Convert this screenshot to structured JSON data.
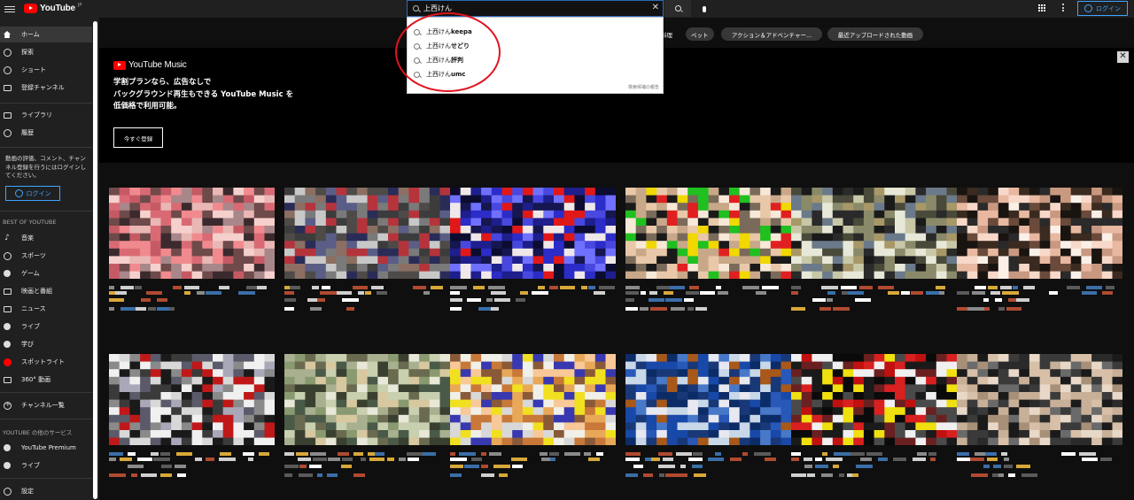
{
  "header": {
    "logo_text": "YouTube",
    "logo_badge": "JP",
    "search_value": "上西けん",
    "login_label": "ログイン"
  },
  "icons": [
    "menu-icon",
    "search-icon",
    "clear-icon",
    "mic-icon",
    "apps-icon",
    "more-vert-icon",
    "account-icon"
  ],
  "sidebar": {
    "items_main": [
      {
        "label": "ホーム",
        "icon": "home-icon",
        "active": true
      },
      {
        "label": "探索",
        "icon": "explore-icon"
      },
      {
        "label": "ショート",
        "icon": "shorts-icon"
      },
      {
        "label": "登録チャンネル",
        "icon": "subscriptions-icon"
      }
    ],
    "items_library": [
      {
        "label": "ライブラリ",
        "icon": "library-icon"
      },
      {
        "label": "履歴",
        "icon": "history-icon"
      }
    ],
    "note": "動画の評価、コメント、チャンネル登録を行うにはログインしてください。",
    "login_label": "ログイン",
    "best_heading": "BEST OF YOUTUBE",
    "best_items": [
      {
        "label": "音楽",
        "icon": "music-icon"
      },
      {
        "label": "スポーツ",
        "icon": "sports-icon"
      },
      {
        "label": "ゲーム",
        "icon": "gaming-icon"
      },
      {
        "label": "映画と番組",
        "icon": "movies-icon"
      },
      {
        "label": "ニュース",
        "icon": "news-icon"
      },
      {
        "label": "ライブ",
        "icon": "live-icon"
      },
      {
        "label": "学び",
        "icon": "learning-icon"
      },
      {
        "label": "スポットライト",
        "icon": "spotlight-icon"
      },
      {
        "label": "360° 動画",
        "icon": "360-icon"
      }
    ],
    "channels_label": "チャンネル一覧",
    "more_heading": "YOUTUBE の他のサービス",
    "more_items": [
      {
        "label": "YouTube Premium",
        "icon": "premium-icon"
      },
      {
        "label": "ライブ",
        "icon": "live-icon"
      }
    ],
    "settings_label": "設定"
  },
  "chips": [
    "料理",
    "ペット",
    "アクション＆アドベンチャー...",
    "最近アップロードされた動画"
  ],
  "banner": {
    "brand": "YouTube Music",
    "line1": "学割プランなら、広告なしで",
    "line2": "バックグラウンド再生もできる YouTube Music を",
    "line3": "低価格で利用可能。",
    "cta": "今すぐ登録",
    "close": "✕"
  },
  "suggestions": {
    "query_prefix": "上西けん",
    "items": [
      {
        "prefix": "上西けん ",
        "suffix": "keepa"
      },
      {
        "prefix": "上西けん ",
        "suffix": "せどり"
      },
      {
        "prefix": "上西けん ",
        "suffix": "評判"
      },
      {
        "prefix": "上西けん ",
        "suffix": "umc"
      }
    ],
    "report_label": "検索候補の報告"
  },
  "videos": {
    "row1_palettes": [
      [
        "#f08a8e",
        "#d96a74",
        "#e9b7b4",
        "#6f4a4a",
        "#c65a64",
        "#f5d0cc",
        "#3b2a2d",
        "#a8878a"
      ],
      [
        "#b5343c",
        "#5a5e86",
        "#7a7a7a",
        "#3c3c3c",
        "#2a2c58",
        "#c8c8c8",
        "#4e4a48",
        "#8c6f62"
      ],
      [
        "#2c2cc8",
        "#1e1e8c",
        "#e01818",
        "#161650",
        "#4848e0",
        "#0c0c30",
        "#7070ff",
        "#f0e8e8"
      ],
      [
        "#e8c8a8",
        "#c8a888",
        "#f0d800",
        "#e02020",
        "#20c020",
        "#7a6a5a",
        "#f8e8d8",
        "#1a1a1a"
      ],
      [
        "#8a8a6a",
        "#4a4a3a",
        "#c8c8a8",
        "#2a2a2a",
        "#6a7a8a",
        "#a89868",
        "#e8e8d8",
        "#1a1a1a"
      ],
      [
        "#1a1410",
        "#3a2a20",
        "#f8d8c8",
        "#e8b8a0",
        "#6a4a3a",
        "#c89880",
        "#2a2a2a",
        "#faf0e8"
      ]
    ],
    "row2_palettes": [
      [
        "#d8d8d8",
        "#8a8a8a",
        "#3a3a3a",
        "#c01818",
        "#f0f0f0",
        "#5a5a6a",
        "#a8a8b8",
        "#1a1a1a"
      ],
      [
        "#c8d0b0",
        "#8a9a70",
        "#4a5a48",
        "#e8e8d8",
        "#6a6a50",
        "#a8b090",
        "#3a4030",
        "#d8c8a0"
      ],
      [
        "#e8a858",
        "#c87838",
        "#f0f0e8",
        "#d8d8d8",
        "#f0e020",
        "#3838b0",
        "#8a5a38",
        "#f8c898"
      ],
      [
        "#1848a8",
        "#0c2c68",
        "#e8e8f0",
        "#4878c8",
        "#a85818",
        "#c8d8e8",
        "#183878",
        "#2858b8"
      ],
      [
        "#0a0a0a",
        "#f0f0f0",
        "#f0e010",
        "#c01010",
        "#1a1a1a",
        "#6a2020",
        "#d82020",
        "#4a4a4a"
      ],
      [
        "#c8b098",
        "#1a1a1a",
        "#3a3a3a",
        "#a89078",
        "#d8c0a8",
        "#2a2a2a",
        "#e8d8c8",
        "#6a6a6a"
      ]
    ]
  },
  "colors": {
    "background": "#0f0f0f",
    "surface": "#202020",
    "accent_blue": "#3ea6ff",
    "brand_red": "#ff0000",
    "annotation_red": "#e0141e"
  }
}
